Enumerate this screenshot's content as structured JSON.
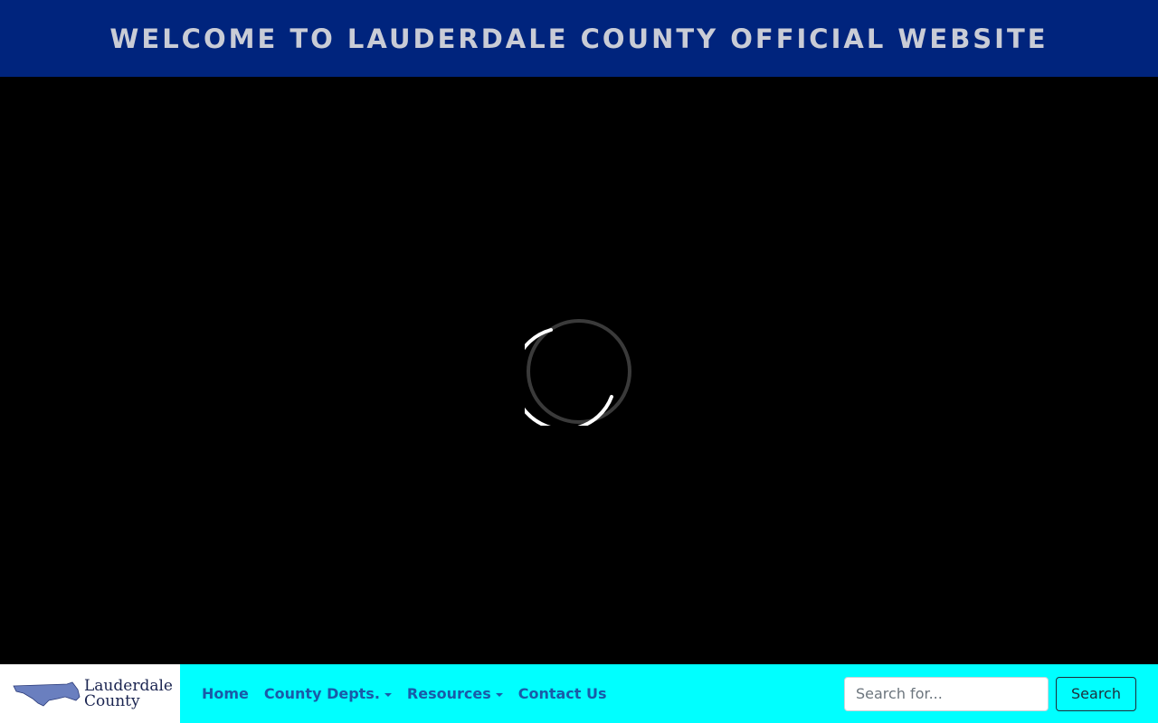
{
  "banner": {
    "title": "WELCOME TO LAUDERDALE COUNTY OFFICIAL WEBSITE"
  },
  "video": {
    "state": "loading"
  },
  "logo": {
    "line1": "Lauderdale",
    "line2": "County"
  },
  "nav": {
    "items": [
      {
        "label": "Home",
        "dropdown": false
      },
      {
        "label": "County Depts.",
        "dropdown": true
      },
      {
        "label": "Resources",
        "dropdown": true
      },
      {
        "label": "Contact Us",
        "dropdown": false
      }
    ]
  },
  "search": {
    "placeholder": "Search for...",
    "value": "",
    "button_label": "Search"
  },
  "colors": {
    "banner_bg": "#00247d",
    "banner_text": "#c9ccd6",
    "navbar_bg": "#00ffff",
    "nav_link": "#1a5aa8",
    "video_bg": "#000000"
  },
  "icons": {
    "spinner": "loading-spinner-icon",
    "logo": "county-map-icon",
    "caret": "caret-down-icon"
  }
}
